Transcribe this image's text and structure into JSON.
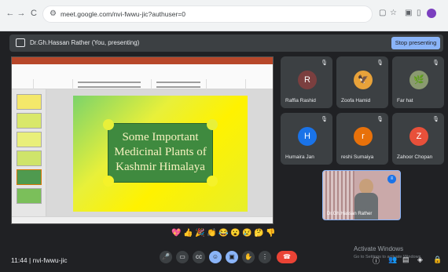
{
  "browser": {
    "back": "←",
    "forward": "→",
    "reload": "C",
    "url": "meet.google.com/nvi-fwwu-jic?authuser=0"
  },
  "meet": {
    "presenter_text": "Dr.Gh.Hassan Rather (You, presenting)",
    "stop_presenting": "Stop presenting",
    "meeting_code": "nvi-fwwu-jic",
    "time": "11:44",
    "activate_title": "Activate Windows",
    "activate_sub": "Go to Settings to activate Windows."
  },
  "slide": {
    "title_line1": "Some Important",
    "title_line2": "Medicinal Plants of",
    "title_line3": "Kashmir Himalaya"
  },
  "participants": [
    {
      "name": "Raffia Rashid",
      "initial": "R",
      "color": "#7b3f3f"
    },
    {
      "name": "Zoofa Hamid",
      "initial": "",
      "color": "#6b4a2a"
    },
    {
      "name": "Far hat",
      "initial": "",
      "color": "#5f6b50"
    },
    {
      "name": "Humaira Jan",
      "initial": "H",
      "color": "#1a73e8"
    },
    {
      "name": "reshi Sumaiya",
      "initial": "r",
      "color": "#e8710a"
    },
    {
      "name": "Zahoor Chopan",
      "initial": "Z",
      "color": "#e8503a"
    }
  ],
  "self_name": "Dr.Gh.Hassan Rather",
  "reactions": [
    "💖",
    "👍",
    "🎉",
    "👏",
    "😂",
    "😮",
    "😢",
    "🤔",
    "👎"
  ]
}
